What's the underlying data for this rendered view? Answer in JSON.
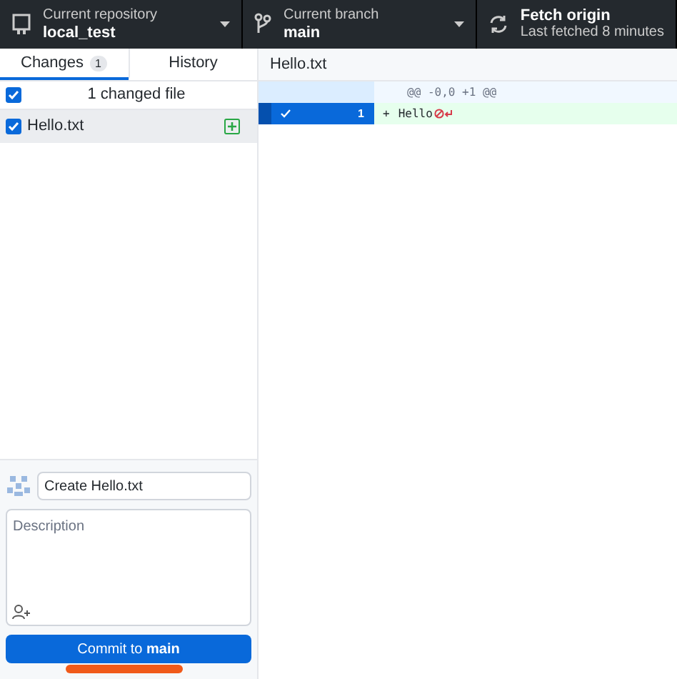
{
  "toolbar": [
    {
      "label": "Current repository",
      "value": "local_test",
      "kind": "repo"
    },
    {
      "label": "Current branch",
      "value": "main",
      "kind": "branch"
    },
    {
      "label": "Fetch origin",
      "value": "Last fetched 8 minutes",
      "kind": "fetch"
    }
  ],
  "tabs": [
    {
      "label": "Changes",
      "count": "1",
      "selected": true
    },
    {
      "label": "History",
      "selected": false
    }
  ],
  "changes_header": {
    "text": "1 changed file",
    "checked": true
  },
  "files": [
    {
      "name": "Hello.txt",
      "checked": true,
      "selected": true
    }
  ],
  "diff": {
    "file": "Hello.txt",
    "hunk": "@@ -0,0 +1 @@",
    "lines": [
      {
        "number": "1",
        "sign": "+",
        "text": "Hello",
        "included": true
      }
    ]
  },
  "commit": {
    "summary": "Create Hello.txt",
    "description_placeholder": "Description",
    "button": "Commit to **main**"
  }
}
